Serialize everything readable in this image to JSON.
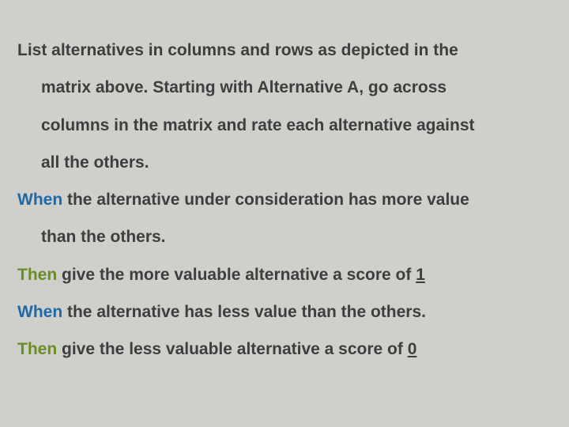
{
  "p1": {
    "l1": "List alternatives in columns and rows as depicted in the",
    "l2": "matrix above. Starting with Alternative A, go across",
    "l3": "columns in the matrix and rate each alternative against",
    "l4": "all the others."
  },
  "p2": {
    "kw": "When",
    "l1": " the alternative under consideration has more value",
    "l2": "than the others."
  },
  "p3": {
    "kw": "Then",
    "l1": " give the more valuable alternative a score of ",
    "score": "1"
  },
  "p4": {
    "kw": "When",
    "l1": " the alternative has less value than the others."
  },
  "p5": {
    "kw": "Then",
    "l1": " give the less valuable alternative a score of ",
    "score": "0"
  }
}
